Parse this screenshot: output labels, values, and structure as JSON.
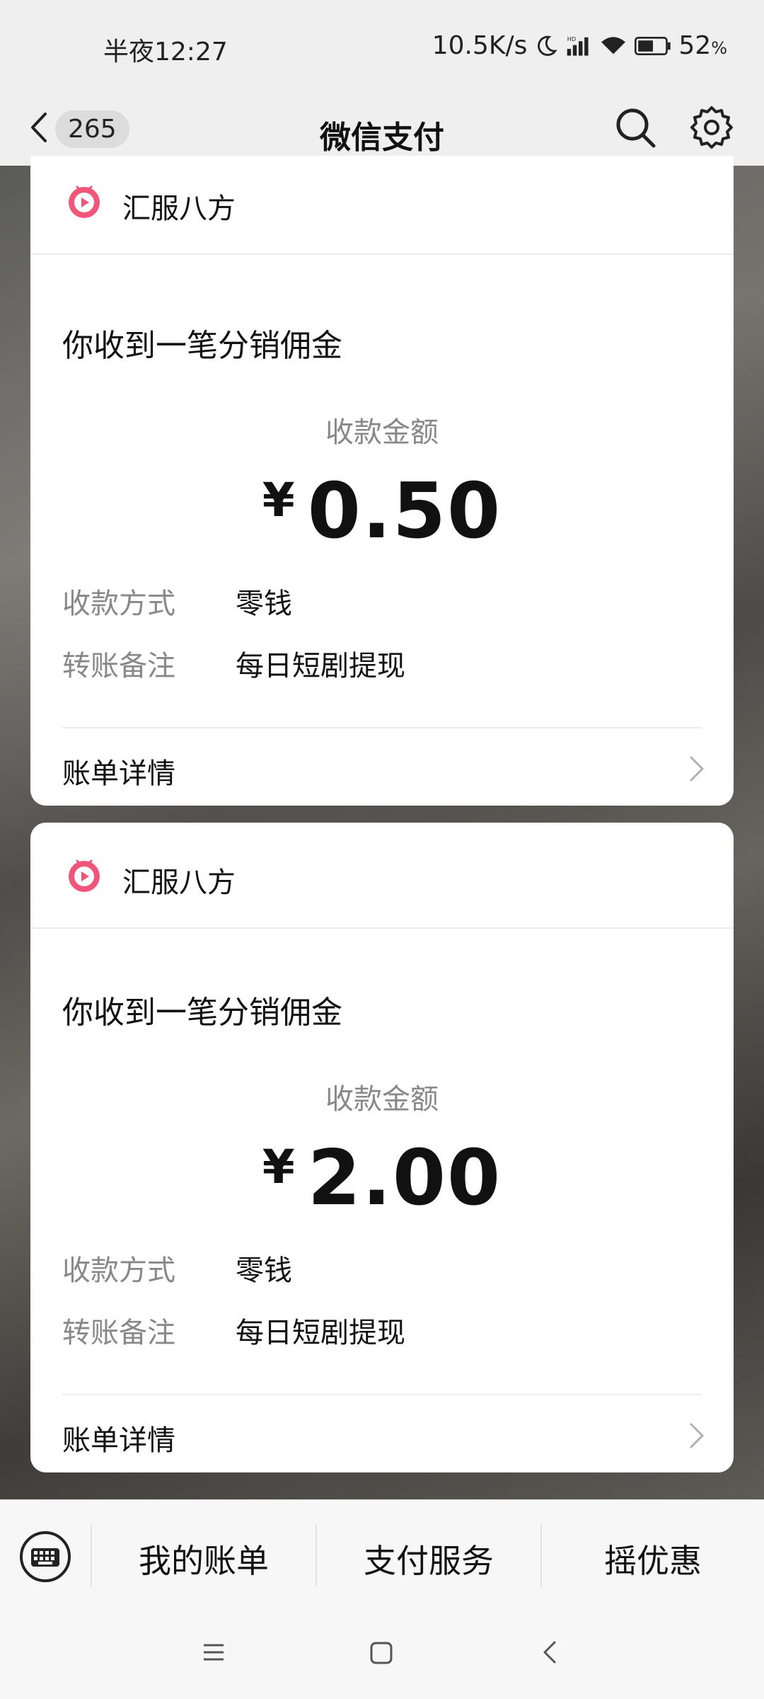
{
  "status_bar": {
    "time": "半夜12:27",
    "network_speed": "10.5K/s",
    "battery": "52",
    "battery_unit": "%"
  },
  "header": {
    "back_count": "265",
    "title": "微信支付"
  },
  "cards": [
    {
      "merchant": "汇服八方",
      "title": "你收到一笔分销佣金",
      "amount_label": "收款金额",
      "currency": "¥",
      "amount": "0.50",
      "rows": [
        {
          "key": "收款方式",
          "value": "零钱"
        },
        {
          "key": "转账备注",
          "value": "每日短剧提现"
        }
      ],
      "detail_label": "账单详情"
    },
    {
      "merchant": "汇服八方",
      "title": "你收到一笔分销佣金",
      "amount_label": "收款金额",
      "currency": "¥",
      "amount": "2.00",
      "rows": [
        {
          "key": "收款方式",
          "value": "零钱"
        },
        {
          "key": "转账备注",
          "value": "每日短剧提现"
        }
      ],
      "detail_label": "账单详情"
    }
  ],
  "bottom_menu": {
    "items": [
      "我的账单",
      "支付服务",
      "摇优惠"
    ]
  },
  "icons": {
    "merchant_icon_color": "#f0567a",
    "accent": "#111111"
  }
}
